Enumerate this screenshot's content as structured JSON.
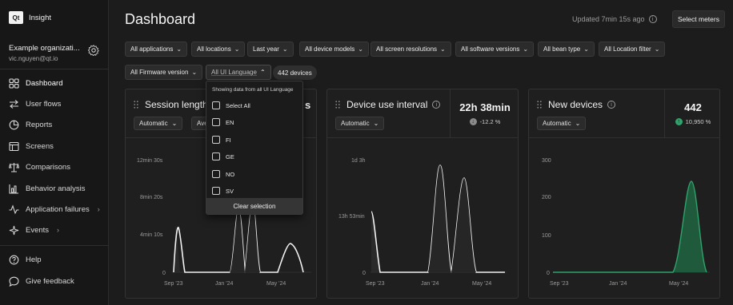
{
  "app": {
    "logo": "Qt",
    "name": "Insight"
  },
  "org": {
    "name": "Example organizati...",
    "email": "vic.nguyen@qt.io"
  },
  "nav": {
    "dashboard": "Dashboard",
    "user_flows": "User flows",
    "reports": "Reports",
    "screens": "Screens",
    "comparisons": "Comparisons",
    "behavior_analysis": "Behavior analysis",
    "application_failures": "Application failures",
    "events": "Events",
    "help": "Help",
    "feedback": "Give feedback"
  },
  "header": {
    "title": "Dashboard",
    "updated": "Updated 7min 15s ago",
    "select_meters": "Select meters"
  },
  "filters": {
    "applications": "All applications",
    "locations": "All locations",
    "time": "Last year",
    "device_models": "All device models",
    "screen_resolutions": "All screen resolutions",
    "software_versions": "All software versions",
    "bean_type": "All bean type",
    "location_filter": "All Location filter",
    "firmware": "All Firmware version",
    "ui_language": "All UI Language",
    "devices_count": "442 devices"
  },
  "dropdown": {
    "heading": "Showing data from all UI Language",
    "options": [
      "Select All",
      "EN",
      "FI",
      "GE",
      "NO",
      "SV"
    ],
    "clear": "Clear selection"
  },
  "cards": {
    "session": {
      "title": "Session length",
      "mode": "Automatic",
      "mode2": "Ave",
      "stat_fragment": "s",
      "y_ticks": [
        "12min 30s",
        "8min 20s",
        "4min 10s",
        "0"
      ],
      "x_ticks": [
        "Sep '23",
        "Jan '24",
        "May '24"
      ]
    },
    "device_use": {
      "title": "Device use interval",
      "mode": "Automatic",
      "stat_value": "22h 38min",
      "stat_delta": "-12.2 %",
      "y_ticks": [
        "1d 3h",
        "13h 53min",
        "0"
      ],
      "x_ticks": [
        "Sep '23",
        "Jan '24",
        "May '24"
      ]
    },
    "new_devices": {
      "title": "New devices",
      "mode": "Automatic",
      "stat_value": "442",
      "stat_delta": "10,950 %",
      "y_ticks": [
        "300",
        "200",
        "100",
        "0"
      ],
      "x_ticks": [
        "Sep '23",
        "Jan '24",
        "May '24"
      ],
      "accent": "#2fa36b"
    }
  }
}
